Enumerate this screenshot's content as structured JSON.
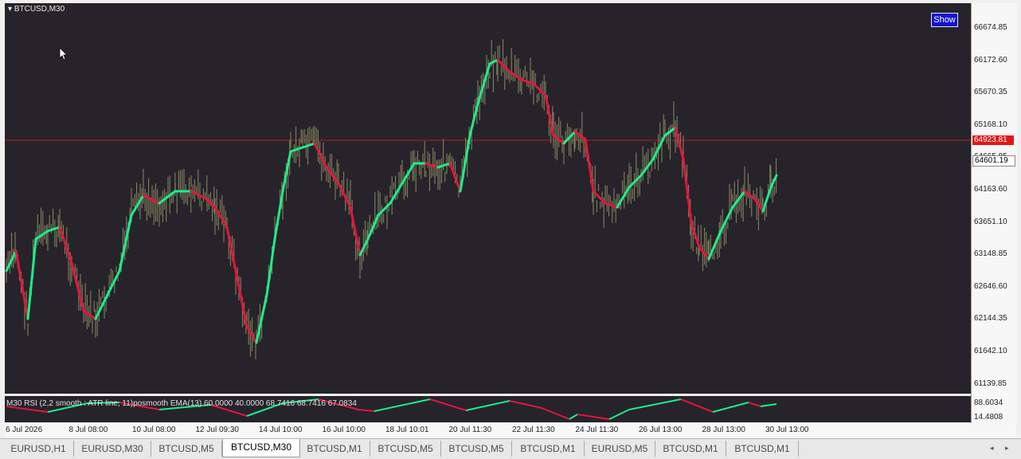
{
  "chart": {
    "symbol": "BTCUSD,M30",
    "show_button": "Show",
    "current_price_red": "64923.81",
    "current_price_white": "64601.19",
    "price_levels": [
      "66674.85",
      "66172.60",
      "65670.35",
      "65168.10",
      "64665.85",
      "64163.60",
      "63651.10",
      "63148.85",
      "62646.60",
      "62144.35",
      "61642.10",
      "61139.85"
    ],
    "time_labels": [
      "6 Jul 2026",
      "8 Jul 08:00",
      "10 Jul 08:00",
      "12 Jul 09:30",
      "14 Jul 10:00",
      "16 Jul 10:00",
      "18 Jul 10:01",
      "20 Jul 11:30",
      "22 Jul 11:30",
      "24 Jul 11:30",
      "26 Jul 13:00",
      "28 Jul 13:00",
      "30 Jul 13:00"
    ],
    "colors": {
      "background": "#27232b",
      "bull": "#19f08a",
      "bear": "#e0183c",
      "candle": "#8a8a62",
      "current_line": "#b81818"
    }
  },
  "indicator": {
    "label": "M30 RSI (2,2 smooth : ATR line, 11)posmooth EMA(13) 60.0000 40.0000 68.7416 68.7416 67.0834",
    "levels": [
      "88.6034",
      "14.4808"
    ]
  },
  "tabs": [
    {
      "label": "EURUSD,H1",
      "active": false
    },
    {
      "label": "EURUSD,M30",
      "active": false
    },
    {
      "label": "BTCUSD,M5",
      "active": false
    },
    {
      "label": "BTCUSD,M30",
      "active": true
    },
    {
      "label": "BTCUSD,M1",
      "active": false
    },
    {
      "label": "BTCUSD,M5",
      "active": false
    },
    {
      "label": "BTCUSD,M5",
      "active": false
    },
    {
      "label": "BTCUSD,M1",
      "active": false
    },
    {
      "label": "EURUSD,M5",
      "active": false
    },
    {
      "label": "BTCUSD,M1",
      "active": false
    },
    {
      "label": "BTCUSD,M1",
      "active": false
    }
  ]
}
